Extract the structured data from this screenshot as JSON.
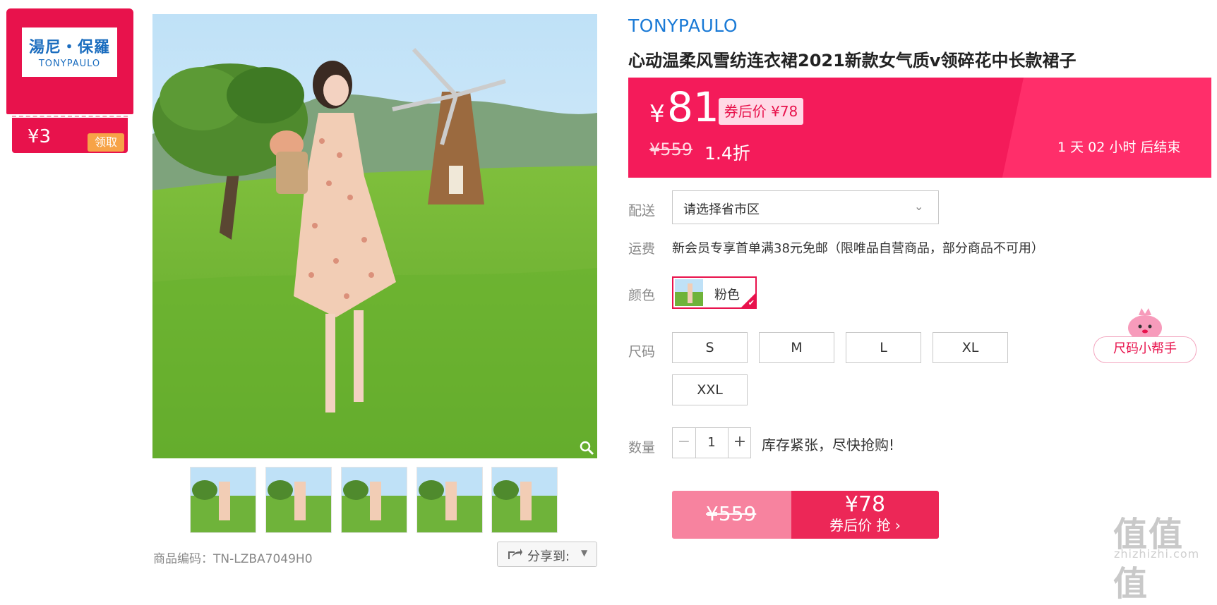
{
  "coupon": {
    "brand_cn": "湯尼・保羅",
    "brand_en": "TONYPAULO",
    "amount": "¥3",
    "take_label": "领取"
  },
  "product": {
    "brand": "TONYPAULO",
    "title": "心动温柔风雪纺连衣裙2021新款女气质v领碎花中长款裙子",
    "code_label": "商品编码：TN-LZBA7049H0"
  },
  "price": {
    "currency": "¥",
    "value": "81",
    "coupon_tag": "券后价 ¥78",
    "original": "¥559",
    "discount": "1.4折",
    "timer": "1 天 02 小时 后结束"
  },
  "share": {
    "label": "分享到:"
  },
  "delivery": {
    "label": "配送",
    "value": "请选择省市区"
  },
  "freight": {
    "label": "运费",
    "text": "新会员专享首单满38元免邮（限唯品自营商品，部分商品不可用）"
  },
  "color": {
    "label": "颜色",
    "selected": "粉色"
  },
  "size": {
    "label": "尺码",
    "options": [
      "S",
      "M",
      "L",
      "XL",
      "XXL"
    ],
    "helper_label": "尺码小帮手"
  },
  "quantity": {
    "label": "数量",
    "value": "1",
    "minus": "−",
    "plus": "+",
    "stock_note": "库存紧张，尽快抢购!"
  },
  "buy": {
    "original": "¥559",
    "price": "¥78",
    "cta": "券后价 抢 ›"
  },
  "watermark": {
    "main": "值值值",
    "sub": "zhizhizhi.com"
  },
  "colors": {
    "accent": "#f41b5a",
    "brand_blue": "#1a7ad6",
    "coupon_red": "#e8124c"
  }
}
